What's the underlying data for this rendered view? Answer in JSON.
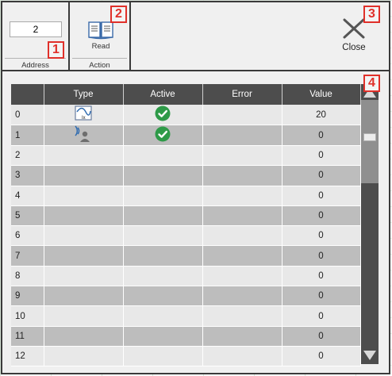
{
  "ribbon": {
    "address": {
      "value": "2",
      "label": "Address"
    },
    "action": {
      "read_label": "Read",
      "group_label": "Action"
    },
    "close_label": "Close"
  },
  "callouts": [
    "1",
    "2",
    "3",
    "4"
  ],
  "table": {
    "headers": [
      "",
      "Type",
      "Active",
      "Error",
      "Value"
    ],
    "rows": [
      {
        "index": "0",
        "type_icon": "analog-input-icon",
        "active": true,
        "active_icon": "check-circle-icon",
        "error": "",
        "value": "20"
      },
      {
        "index": "1",
        "type_icon": "rfid-reader-icon",
        "active": true,
        "active_icon": "check-circle-icon",
        "error": "",
        "value": "0"
      },
      {
        "index": "2",
        "type_icon": "",
        "active": false,
        "error": "",
        "value": "0"
      },
      {
        "index": "3",
        "type_icon": "",
        "active": false,
        "error": "",
        "value": "0"
      },
      {
        "index": "4",
        "type_icon": "",
        "active": false,
        "error": "",
        "value": "0"
      },
      {
        "index": "5",
        "type_icon": "",
        "active": false,
        "error": "",
        "value": "0"
      },
      {
        "index": "6",
        "type_icon": "",
        "active": false,
        "error": "",
        "value": "0"
      },
      {
        "index": "7",
        "type_icon": "",
        "active": false,
        "error": "",
        "value": "0"
      },
      {
        "index": "8",
        "type_icon": "",
        "active": false,
        "error": "",
        "value": "0"
      },
      {
        "index": "9",
        "type_icon": "",
        "active": false,
        "error": "",
        "value": "0"
      },
      {
        "index": "10",
        "type_icon": "",
        "active": false,
        "error": "",
        "value": "0"
      },
      {
        "index": "11",
        "type_icon": "",
        "active": false,
        "error": "",
        "value": "0"
      },
      {
        "index": "12",
        "type_icon": "",
        "active": false,
        "error": "",
        "value": "0"
      }
    ]
  },
  "colors": {
    "header_bg": "#4d4d4d",
    "row_dark": "#bdbdbd",
    "row_light": "#e8e8e8",
    "check_green": "#2e9a48",
    "callout_red": "#e0302a"
  }
}
